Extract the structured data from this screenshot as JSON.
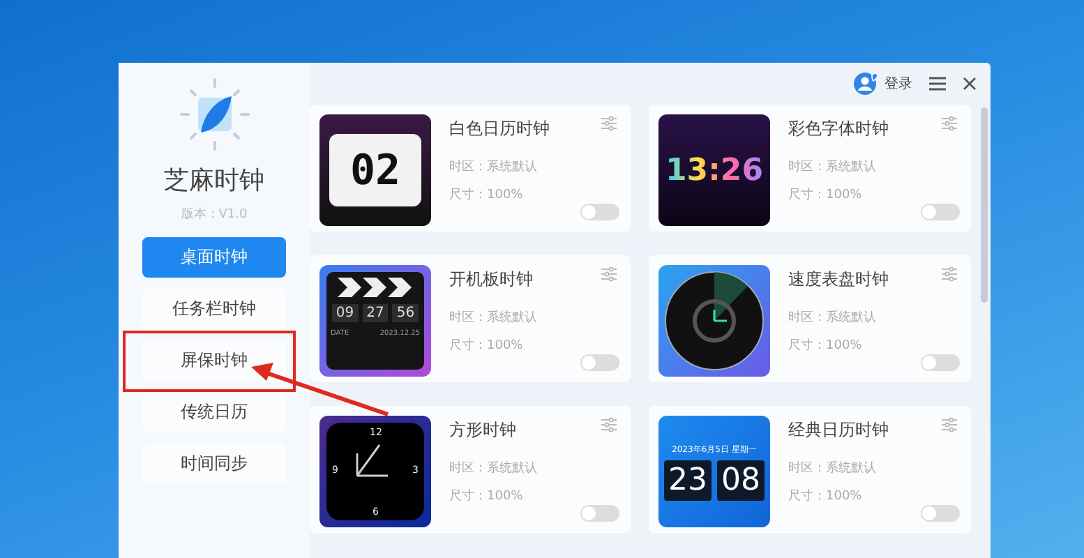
{
  "app": {
    "name": "芝麻时钟",
    "version": "版本：V1.0"
  },
  "header": {
    "login": "登录"
  },
  "sidebar": {
    "items": [
      {
        "label": "桌面时钟",
        "selected": true
      },
      {
        "label": "任务栏时钟",
        "selected": false
      },
      {
        "label": "屏保时钟",
        "selected": false
      },
      {
        "label": "传统日历",
        "selected": false
      },
      {
        "label": "时间同步",
        "selected": false
      }
    ]
  },
  "cards": [
    {
      "title": "白色日历时钟",
      "timezone": "时区：系统默认",
      "size": "尺寸：100%",
      "on": false,
      "thumb": {
        "kind": "flip",
        "texts": [
          "02"
        ]
      }
    },
    {
      "title": "彩色字体时钟",
      "timezone": "时区：系统默认",
      "size": "尺寸：100%",
      "on": false,
      "thumb": {
        "kind": "rainbow",
        "texts": [
          "13:26"
        ]
      }
    },
    {
      "title": "开机板时钟",
      "timezone": "时区：系统默认",
      "size": "尺寸：100%",
      "on": false,
      "thumb": {
        "kind": "clapper",
        "texts": [
          "09",
          "27",
          "56",
          "DATE",
          "2023.12.25"
        ]
      }
    },
    {
      "title": "速度表盘时钟",
      "timezone": "时区：系统默认",
      "size": "尺寸：100%",
      "on": false,
      "thumb": {
        "kind": "dial"
      }
    },
    {
      "title": "方形时钟",
      "timezone": "时区：系统默认",
      "size": "尺寸：100%",
      "on": false,
      "thumb": {
        "kind": "square",
        "texts": [
          "12",
          "3",
          "6",
          "9"
        ]
      }
    },
    {
      "title": "经典日历时钟",
      "timezone": "时区：系统默认",
      "size": "尺寸：100%",
      "on": false,
      "thumb": {
        "kind": "calendar",
        "texts": [
          "2023年6月5日",
          "星期一",
          "23",
          "08"
        ]
      }
    }
  ]
}
